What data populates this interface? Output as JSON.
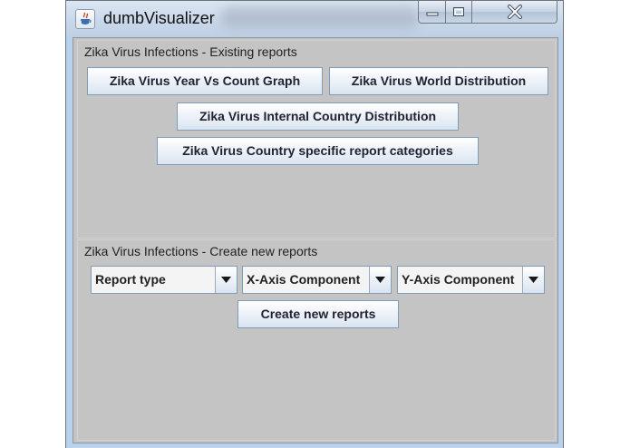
{
  "window": {
    "title": "dumbVisualizer",
    "icon": "java-cup-icon",
    "controls": {
      "minimize": "minimize-icon",
      "maximize": "maximize-icon",
      "close": "close-icon"
    }
  },
  "existing_reports": {
    "title": "Zika Virus Infections - Existing reports",
    "buttons": {
      "year_vs_count": "Zika Virus Year Vs Count Graph",
      "world_distribution": "Zika Virus World Distribution",
      "internal_country": "Zika Virus Internal Country Distribution",
      "country_categories": "Zika Virus Country specific report categories"
    }
  },
  "create_reports": {
    "title": "Zika Virus Infections - Create new reports",
    "report_type": "Report type",
    "x_axis": "X-Axis Component",
    "y_axis": "Y-Axis Component",
    "create_button": "Create new reports"
  },
  "colors": {
    "panel_bg": "#c4c4c4",
    "button_border": "#7f9db9",
    "titlebar_bg": "#c9d8ea"
  }
}
